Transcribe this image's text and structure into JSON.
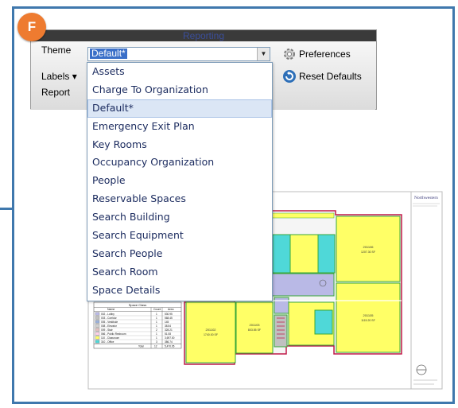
{
  "badge": {
    "letter": "F"
  },
  "panel": {
    "header_title": "Reporting",
    "theme_label": "Theme",
    "theme_value": "Default*",
    "labels_label": "Labels",
    "report_label": "Report",
    "preferences_label": "Preferences",
    "reset_defaults_label": "Reset Defaults"
  },
  "theme_options": [
    "Assets",
    "Charge To Organization",
    "Default*",
    "Emergency Exit Plan",
    "Key Rooms",
    "Occupancy Organization",
    "People",
    "Reservable Spaces",
    "Search Building",
    "Search Equipment",
    "Search People",
    "Search Room",
    "Space Details"
  ],
  "selected_option": "Default*",
  "floor_plan": {
    "title_block_name": "Northwestern",
    "legend_title": "Space Class",
    "legend_headers": [
      "Name",
      "Count",
      "Area"
    ],
    "legend_rows": [
      {
        "name": "002 - Lobby",
        "count": "1",
        "area": "530.95",
        "color": "#b9b9e6"
      },
      {
        "name": "003 - Corridor",
        "count": "1",
        "area": "568.45",
        "color": "#c0c0c0"
      },
      {
        "name": "005 - Vestibule",
        "count": "1",
        "area": "145",
        "color": "#9ab0d8"
      },
      {
        "name": "008 - Elevator",
        "count": "1",
        "area": "38.54",
        "color": "#d0d0d0"
      },
      {
        "name": "009 - Stair",
        "count": "2",
        "area": "328.21",
        "color": "#e0c0c0"
      },
      {
        "name": "066 - Public Restroom",
        "count": "1",
        "area": "51.08",
        "color": "#ffd0e8"
      },
      {
        "name": "110 - Classroom",
        "count": "1",
        "area": "3,697.00",
        "color": "#ffff66"
      },
      {
        "name": "310 - Office",
        "count": "3",
        "area": "386.74",
        "color": "#4fd8d8"
      }
    ],
    "legend_total": {
      "label": "Total",
      "count": "12",
      "area": "5,470.05"
    },
    "rooms": [
      {
        "id": "201102",
        "area": "1740.00 SF"
      },
      {
        "id": "201103",
        "area": "803.55 SF"
      },
      {
        "id": "201104",
        "area": "740.32 SF"
      },
      {
        "id": "201105",
        "area": "1115.20 SF"
      },
      {
        "id": "201106",
        "area": "1207.30 SF"
      }
    ]
  },
  "colors": {
    "frame_border": "#3f78ad",
    "badge": "#ee7b30",
    "selection": "#3a6fc8",
    "classroom": "#ffff66",
    "office": "#4fd8d8",
    "lobby": "#b9b9e6"
  }
}
